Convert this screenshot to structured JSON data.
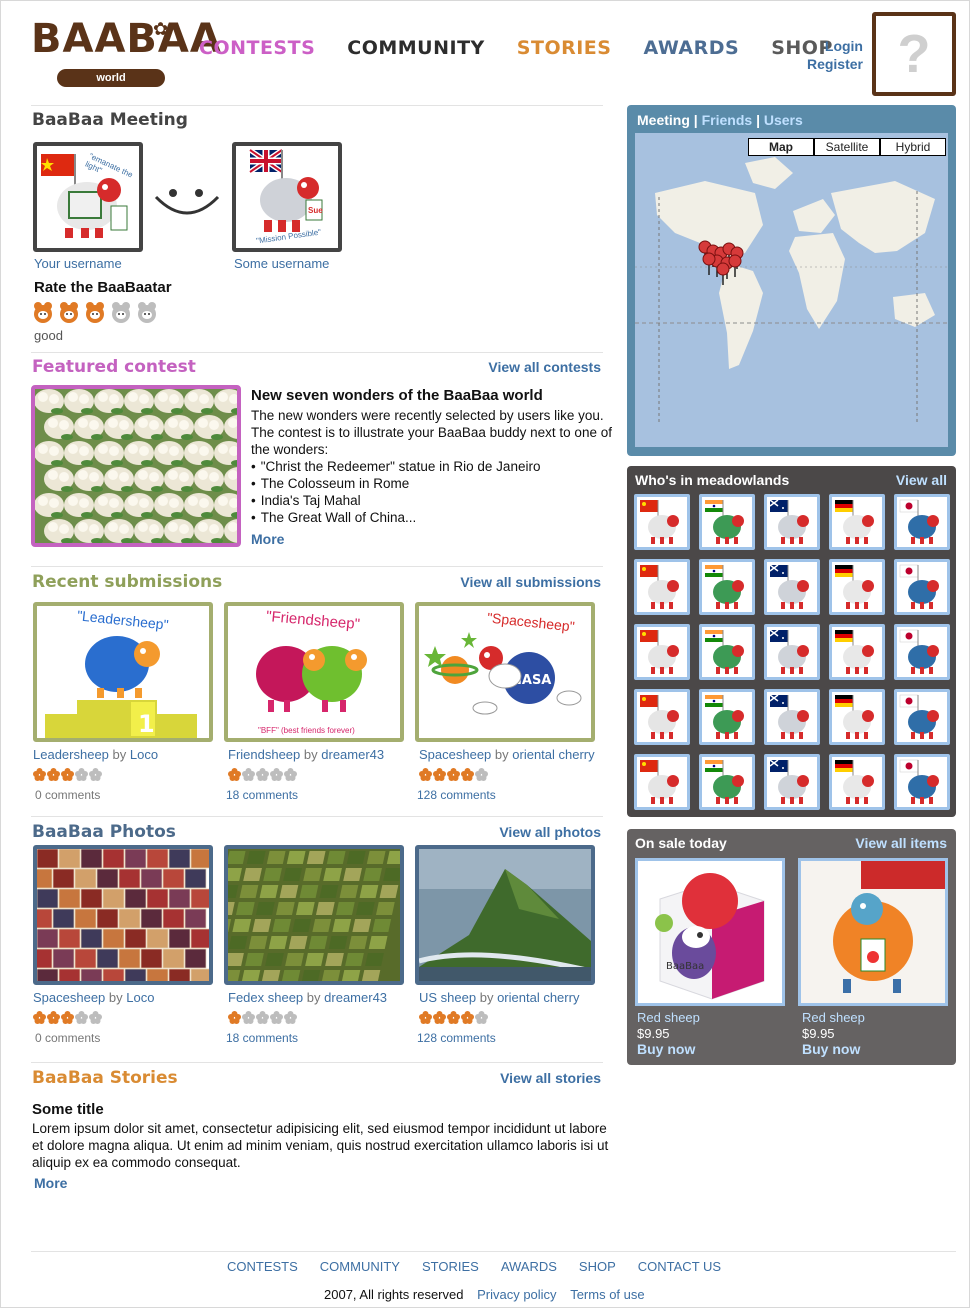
{
  "brand": {
    "logo_text": "BAABAA",
    "logo_sub": "world"
  },
  "nav": {
    "items": [
      {
        "label": "CONTESTS",
        "color": "#cc5fc6"
      },
      {
        "label": "COMMUNITY",
        "color": "#2d2d2d"
      },
      {
        "label": "STORIES",
        "color": "#d98b33"
      },
      {
        "label": "AWARDS",
        "color": "#4d6d93"
      },
      {
        "label": "SHOP",
        "color": "#5a5a5a"
      }
    ],
    "login": "Login",
    "register": "Register",
    "avatar_placeholder": "?"
  },
  "meeting": {
    "title": "BaaBaa Meeting",
    "left_caption": "Your username",
    "right_caption": "Some username",
    "left_card_text": "\"emanate the light\"",
    "right_card_text": "\"Mission Possible\"",
    "right_card_name": "Sue",
    "rate_title": "Rate the BaaBaatar",
    "rating": 3,
    "rating_max": 5,
    "rating_label": "good"
  },
  "featured": {
    "title": "Featured contest",
    "view_all": "View all contests",
    "headline": "New seven wonders of the BaaBaa world",
    "intro": "The new wonders were recently selected by users like you. The contest is to illustrate your BaaBaa buddy next to one of the wonders:",
    "bullets": [
      "\"Christ the Redeemer\" statue in Rio de Janeiro",
      "The Colosseum in Rome",
      "India's Taj Mahal",
      "The Great Wall of China..."
    ],
    "more": "More"
  },
  "submissions": {
    "title": "Recent submissions",
    "view_all": "View all submissions",
    "items": [
      {
        "art_title": "\"Leadersheep\"",
        "title": "Leadersheep",
        "by": "by",
        "author": "Loco",
        "rating": 3,
        "comments": "0 comments",
        "comment_color": "#777777"
      },
      {
        "art_title": "\"Friendsheep\"",
        "art_sub": "\"BFF\" (best friends forever)",
        "title": "Friendsheep",
        "by": "by",
        "author": "dreamer43",
        "rating": 1,
        "comments": "18 comments",
        "comment_color": "#3d6fa3"
      },
      {
        "art_title": "\"Spacesheep\"",
        "art_badge": "NASA",
        "title": "Spacesheep",
        "by": "by",
        "author": "oriental cherry",
        "rating": 4,
        "comments": "128 comments",
        "comment_color": "#3d6fa3"
      }
    ]
  },
  "photos": {
    "title": "BaaBaa Photos",
    "view_all": "View all photos",
    "items": [
      {
        "title": "Spacesheep",
        "by": "by",
        "author": "Loco",
        "rating": 3,
        "comments": "0 comments",
        "comment_color": "#777777"
      },
      {
        "title": "Fedex sheep",
        "by": "by",
        "author": "dreamer43",
        "rating": 1,
        "comments": "18 comments",
        "comment_color": "#3d6fa3"
      },
      {
        "title": "US sheep",
        "by": "by",
        "author": "oriental cherry",
        "rating": 4,
        "comments": "128 comments",
        "comment_color": "#3d6fa3"
      }
    ]
  },
  "stories": {
    "title": "BaaBaa Stories",
    "view_all": "View all stories",
    "headline": "Some title",
    "body": "Lorem ipsum dolor sit amet, consectetur adipisicing elit, sed eiusmod tempor incididunt ut labore et dolore magna aliqua. Ut enim ad minim veniam, quis nostrud exercitation ullamco laboris isi ut aliquip ex ea commodo consequat.",
    "more": "More"
  },
  "map": {
    "tab_meeting": "Meeting",
    "sep1": "|",
    "tab_friends": "Friends",
    "sep2": "|",
    "tab_users": "Users",
    "type_map": "Map",
    "type_satellite": "Satellite",
    "type_hybrid": "Hybrid"
  },
  "meadow": {
    "title": "Who's in meadowlands",
    "view_all": "View all",
    "columns": [
      {
        "flag": "china"
      },
      {
        "flag": "india"
      },
      {
        "flag": "australia"
      },
      {
        "flag": "germany"
      },
      {
        "flag": "japan"
      }
    ],
    "row_count": 5
  },
  "sale": {
    "title": "On sale today",
    "view_all": "View all items",
    "items": [
      {
        "name": "Red sheep",
        "price": "$9.95",
        "buy": "Buy now"
      },
      {
        "name": "Red sheep",
        "price": "$9.95",
        "buy": "Buy now"
      }
    ]
  },
  "footer": {
    "nav": [
      "CONTESTS",
      "COMMUNITY",
      "STORIES",
      "AWARDS",
      "SHOP",
      "CONTACT US"
    ],
    "copyright": "2007, All rights reserved",
    "privacy": "Privacy policy",
    "terms": "Terms of use"
  },
  "colors": {
    "link": "#3d6fa3",
    "brown": "#5a3318",
    "featured": "#c462c0",
    "submissions": "#8fa05a",
    "photos": "#4c6a8a",
    "stories": "#d98b33",
    "rating_on": "#e07a25",
    "rating_off": "#bdbdbd"
  }
}
